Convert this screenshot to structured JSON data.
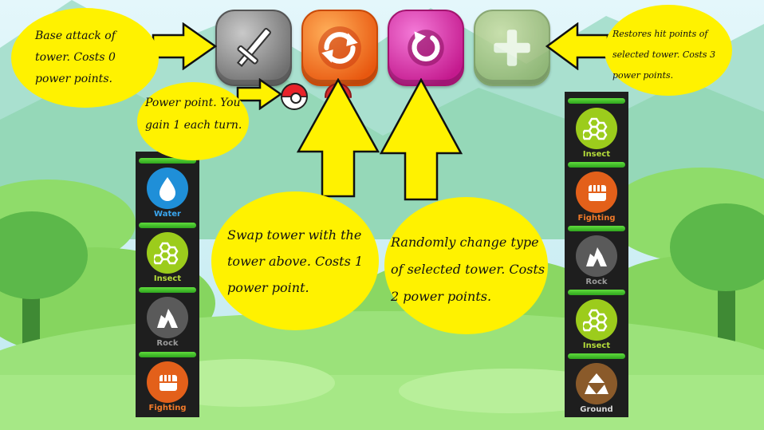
{
  "actions": [
    {
      "id": "attack",
      "icon": "sword-icon"
    },
    {
      "id": "swap",
      "icon": "swap-arrows-icon"
    },
    {
      "id": "change",
      "icon": "refresh-icon"
    },
    {
      "id": "heal",
      "icon": "plus-icon"
    }
  ],
  "power_points": {
    "available": 1,
    "slots": 2
  },
  "callouts": {
    "attack": "Base attack of tower. Costs 0 power points.",
    "heal": "Restores hit points of selected tower. Costs 3 power points.",
    "power": "Power point. You gain 1 each turn.",
    "swap": "Swap tower with the tower above. Costs 1 power point.",
    "change": "Randomly change type of selected tower. Costs 2 power points."
  },
  "left_column": [
    {
      "type": "Water",
      "icon": "water-drop-icon",
      "color": "#1f8fd8",
      "label_color": "#3aa6f0",
      "hp": 1.0
    },
    {
      "type": "Insect",
      "icon": "honeycomb-icon",
      "color": "#9ccc1c",
      "label_color": "#b5dd3a",
      "hp": 1.0
    },
    {
      "type": "Rock",
      "icon": "rock-icon",
      "color": "#5a5a5a",
      "label_color": "#9a9a9a",
      "hp": 1.0
    },
    {
      "type": "Fighting",
      "icon": "fist-icon",
      "color": "#e3601a",
      "label_color": "#f07a2a",
      "hp": 1.0
    }
  ],
  "right_column": [
    {
      "type": "Insect",
      "icon": "honeycomb-icon",
      "color": "#9ccc1c",
      "label_color": "#b5dd3a",
      "hp": 1.0
    },
    {
      "type": "Fighting",
      "icon": "fist-icon",
      "color": "#e3601a",
      "label_color": "#f07a2a",
      "hp": 1.0
    },
    {
      "type": "Rock",
      "icon": "rock-icon",
      "color": "#5a5a5a",
      "label_color": "#9a9a9a",
      "hp": 1.0
    },
    {
      "type": "Insect",
      "icon": "honeycomb-icon",
      "color": "#9ccc1c",
      "label_color": "#b5dd3a",
      "hp": 1.0
    },
    {
      "type": "Ground",
      "icon": "ground-icon",
      "color": "#8a5a2a",
      "label_color": "#d8d8d8",
      "hp": 1.0
    }
  ],
  "colors": {
    "callout": "#fff200",
    "sky": "#c6ecf4",
    "grass": "#7fd35a",
    "panel": "#1e1e1e"
  }
}
